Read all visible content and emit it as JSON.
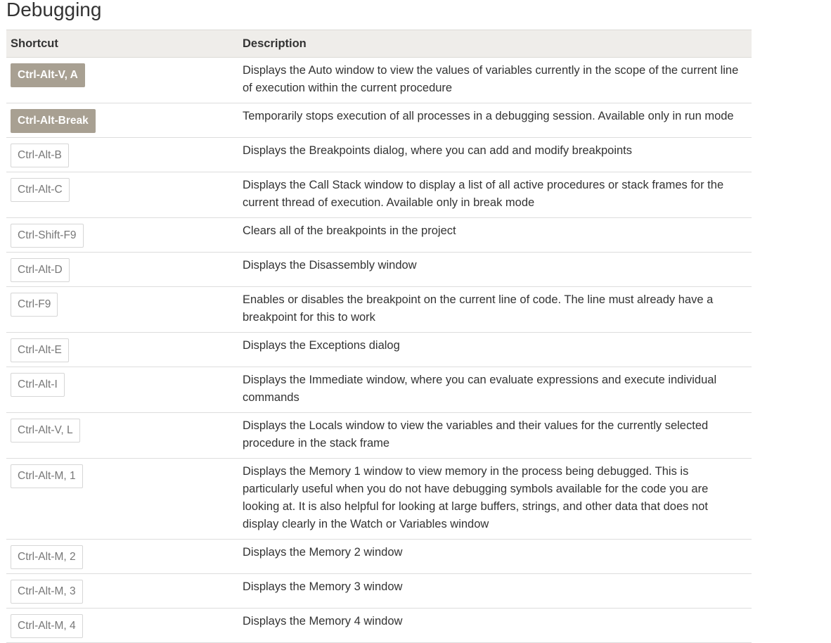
{
  "page": {
    "title": "Debugging"
  },
  "table": {
    "headers": {
      "shortcut": "Shortcut",
      "description": "Description"
    },
    "rows": [
      {
        "shortcut": "Ctrl-Alt-V, A",
        "highlighted": true,
        "description": "Displays the Auto window to view the values of variables currently in the scope of the current line of execution within the current procedure"
      },
      {
        "shortcut": "Ctrl-Alt-Break",
        "highlighted": true,
        "description": "Temporarily stops execution of all processes in a debugging session. Available only in run mode"
      },
      {
        "shortcut": "Ctrl-Alt-B",
        "highlighted": false,
        "description": "Displays the Breakpoints dialog, where you can add and modify breakpoints"
      },
      {
        "shortcut": "Ctrl-Alt-C",
        "highlighted": false,
        "description": "Displays the Call Stack window to display a list of all active procedures or stack frames for the current thread of execution. Available only in break mode"
      },
      {
        "shortcut": "Ctrl-Shift-F9",
        "highlighted": false,
        "description": "Clears all of the breakpoints in the project"
      },
      {
        "shortcut": "Ctrl-Alt-D",
        "highlighted": false,
        "description": "Displays the Disassembly window"
      },
      {
        "shortcut": "Ctrl-F9",
        "highlighted": false,
        "description": "Enables or disables the breakpoint on the current line of code. The line must already have a breakpoint for this to work"
      },
      {
        "shortcut": "Ctrl-Alt-E",
        "highlighted": false,
        "description": "Displays the Exceptions dialog"
      },
      {
        "shortcut": "Ctrl-Alt-I",
        "highlighted": false,
        "description": "Displays the Immediate window, where you can evaluate expressions and execute individual commands"
      },
      {
        "shortcut": "Ctrl-Alt-V, L",
        "highlighted": false,
        "description": "Displays the Locals window to view the variables and their values for the currently selected procedure in the stack frame"
      },
      {
        "shortcut": "Ctrl-Alt-M, 1",
        "highlighted": false,
        "description": "Displays the Memory 1 window to view memory in the process being debugged. This is particularly useful when you do not have debugging symbols available for the code you are looking at. It is also helpful for looking at large buffers, strings, and other data that does not display clearly in the Watch or Variables window"
      },
      {
        "shortcut": "Ctrl-Alt-M, 2",
        "highlighted": false,
        "description": "Displays the Memory 2 window"
      },
      {
        "shortcut": "Ctrl-Alt-M, 3",
        "highlighted": false,
        "description": "Displays the Memory 3 window"
      },
      {
        "shortcut": "Ctrl-Alt-M, 4",
        "highlighted": false,
        "description": "Displays the Memory 4 window"
      }
    ]
  },
  "colors": {
    "highlight_key_bg": "#a8a092",
    "header_bg": "#efedea",
    "text": "#333333",
    "key_text": "#777777"
  }
}
